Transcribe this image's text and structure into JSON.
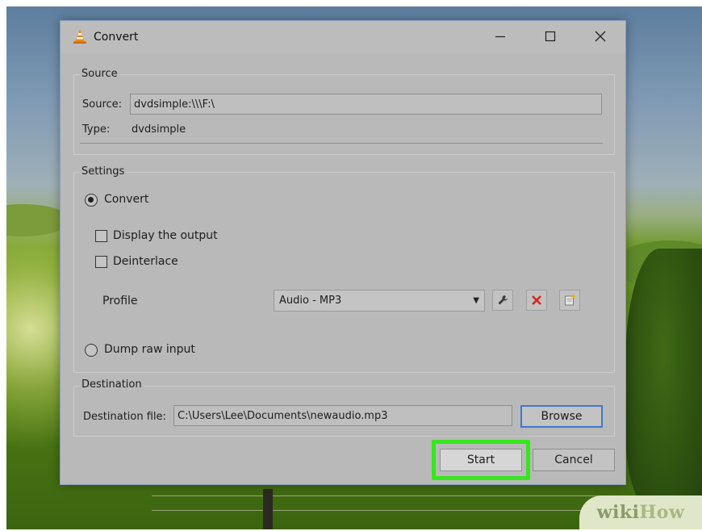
{
  "window": {
    "title": "Convert",
    "icons": {
      "app": "vlc-cone-icon",
      "minimize": "minimize-icon",
      "maximize": "maximize-icon",
      "close": "close-icon"
    }
  },
  "source": {
    "group_title": "Source",
    "source_label": "Source:",
    "source_value": "dvdsimple:\\\\\\F:\\",
    "type_label": "Type:",
    "type_value": "dvdsimple"
  },
  "settings": {
    "group_title": "Settings",
    "convert_label": "Convert",
    "convert_selected": true,
    "display_output_label": "Display the output",
    "display_output_checked": false,
    "deinterlace_label": "Deinterlace",
    "deinterlace_checked": false,
    "profile_label": "Profile",
    "profile_value": "Audio - MP3",
    "dump_raw_label": "Dump raw input",
    "dump_raw_selected": false,
    "tool_icons": [
      "wrench-icon",
      "delete-x-icon",
      "new-profile-icon"
    ]
  },
  "destination": {
    "group_title": "Destination",
    "file_label": "Destination file:",
    "file_value": "C:\\Users\\Lee\\Documents\\newaudio.mp3",
    "browse_label": "Browse"
  },
  "buttons": {
    "start_label": "Start",
    "cancel_label": "Cancel"
  },
  "watermark": {
    "part1": "wiki",
    "part2": "How"
  },
  "colors": {
    "highlight": "#36e61e",
    "browse_border": "#3c78d0",
    "delete_red": "#e02020"
  }
}
